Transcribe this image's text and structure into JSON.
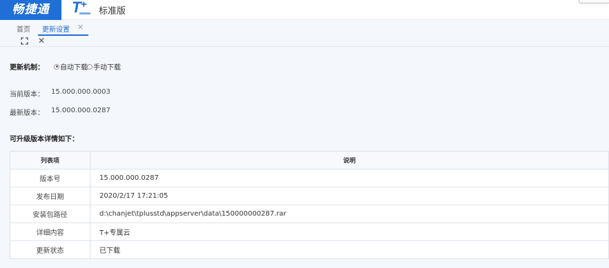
{
  "header": {
    "brand": "畅捷通",
    "product_logo": "T+",
    "edition": "标准版"
  },
  "tabs": [
    {
      "label": "首页",
      "active": false
    },
    {
      "label": "更新设置",
      "active": true,
      "closable": true
    }
  ],
  "toolbar": {
    "expand_icon": "expand-icon",
    "close_icon": "close-icon"
  },
  "settings": {
    "mechanism_label": "更新机制：",
    "options": [
      {
        "label": "自动下载",
        "selected": true
      },
      {
        "label": "手动下载",
        "selected": false
      }
    ],
    "current_version_label": "当前版本：",
    "current_version": "15.000.000.0003",
    "latest_version_label": "最新版本：",
    "latest_version": "15.000.000.0287",
    "details_title": "可升级版本详情如下："
  },
  "table": {
    "headers": [
      "列表项",
      "说明"
    ],
    "rows": [
      {
        "key": "版本号",
        "value": "15.000.000.0287"
      },
      {
        "key": "发布日期",
        "value": "2020/2/17 17:21:05"
      },
      {
        "key": "安装包路径",
        "value": "d:\\chanjet\\tplusstd\\appserver\\data\\150000000287.rar"
      },
      {
        "key": "详细内容",
        "value": " T+专属云"
      },
      {
        "key": "更新状态",
        "value": " 已下载"
      }
    ]
  },
  "colors": {
    "accent": "#1f6fd6",
    "background": "#f4f7fb"
  }
}
